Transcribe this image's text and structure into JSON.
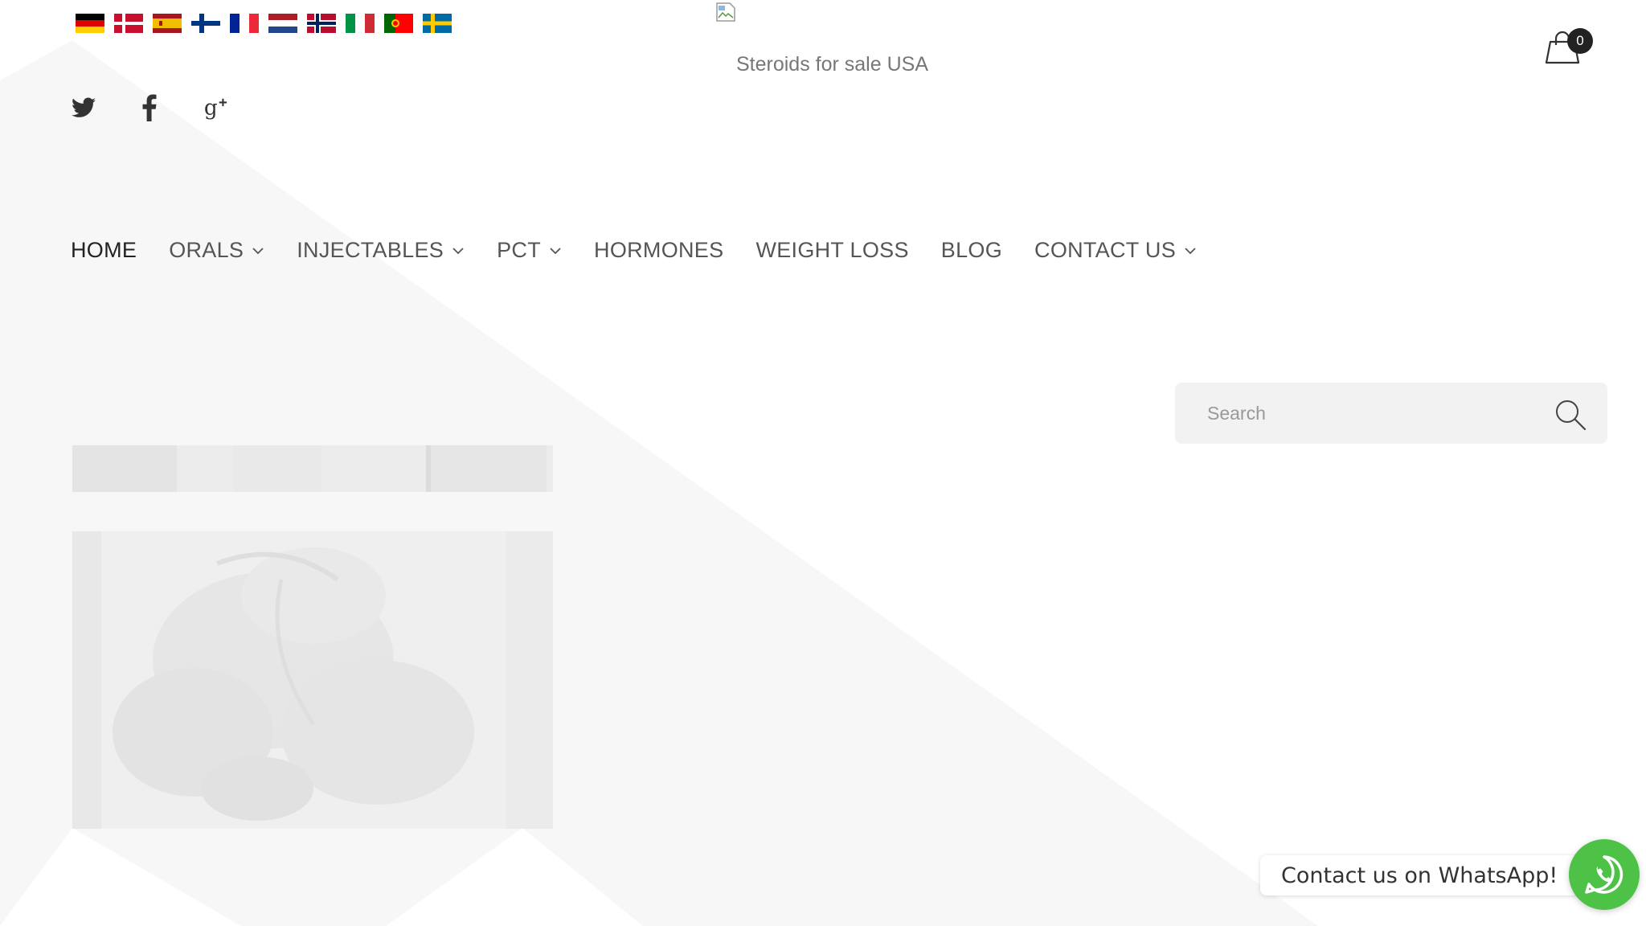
{
  "header": {
    "languages": [
      {
        "name": "german-flag-icon",
        "lang": "German"
      },
      {
        "name": "danish-flag-icon",
        "lang": "Danish"
      },
      {
        "name": "spanish-flag-icon",
        "lang": "Spanish"
      },
      {
        "name": "finnish-flag-icon",
        "lang": "Finnish"
      },
      {
        "name": "french-flag-icon",
        "lang": "French"
      },
      {
        "name": "dutch-flag-icon",
        "lang": "Dutch"
      },
      {
        "name": "norwegian-flag-icon",
        "lang": "Norwegian"
      },
      {
        "name": "italian-flag-icon",
        "lang": "Italian"
      },
      {
        "name": "portuguese-flag-icon",
        "lang": "Portuguese"
      },
      {
        "name": "swedish-flag-icon",
        "lang": "Swedish"
      }
    ],
    "social": [
      "twitter-icon",
      "facebook-icon",
      "google-plus-icon"
    ],
    "logo_alt": "Steroids for sale USA",
    "cart": {
      "icon": "shopping-bag-icon",
      "count": "0"
    }
  },
  "nav": {
    "items": [
      {
        "label": "HOME",
        "has_dropdown": false,
        "active": true
      },
      {
        "label": "ORALS",
        "has_dropdown": true,
        "active": false
      },
      {
        "label": "INJECTABLES",
        "has_dropdown": true,
        "active": false
      },
      {
        "label": "PCT",
        "has_dropdown": true,
        "active": false
      },
      {
        "label": "HORMONES",
        "has_dropdown": false,
        "active": false
      },
      {
        "label": "WEIGHT LOSS",
        "has_dropdown": false,
        "active": false
      },
      {
        "label": "BLOG",
        "has_dropdown": false,
        "active": false
      },
      {
        "label": "CONTACT US",
        "has_dropdown": true,
        "active": false
      }
    ]
  },
  "search": {
    "placeholder": "Search",
    "value": "",
    "icon": "search-icon"
  },
  "whatsapp": {
    "label": "Contact us on WhatsApp!",
    "icon": "whatsapp-icon",
    "color": "#4dc247"
  },
  "colors": {
    "nav_text": "#555555",
    "nav_active": "#222222",
    "background_deco": "#f7f7f7"
  }
}
